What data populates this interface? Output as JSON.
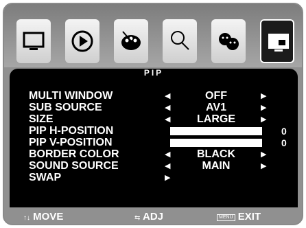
{
  "title": "PIP",
  "tabs": [
    {
      "icon": "monitor-icon"
    },
    {
      "icon": "play-icon"
    },
    {
      "icon": "palette-icon"
    },
    {
      "icon": "magnifier-icon"
    },
    {
      "icon": "faces-icon"
    },
    {
      "icon": "pip-monitor-icon",
      "active": true
    }
  ],
  "rows": [
    {
      "label": "MULTI WINDOW",
      "value": "OFF"
    },
    {
      "label": "SUB SOURCE",
      "value": "AV1"
    },
    {
      "label": "SIZE",
      "value": "LARGE"
    },
    {
      "label": "PIP H-POSITION",
      "level": 1.0,
      "number": "0"
    },
    {
      "label": "PIP V-POSITION",
      "level": 1.0,
      "number": "0"
    },
    {
      "label": "BORDER COLOR",
      "value": "BLACK"
    },
    {
      "label": "SOUND SOURCE",
      "value": "MAIN"
    },
    {
      "label": "SWAP"
    }
  ],
  "footer": {
    "move_glyph": "↑↓",
    "move": "MOVE",
    "adj_glyph": "⇆",
    "adj": "ADJ",
    "menu_glyph": "MENU",
    "exit": "EXIT"
  },
  "colors": {
    "panel": "#000000",
    "frame": "#909090",
    "text": "#ffffff"
  }
}
